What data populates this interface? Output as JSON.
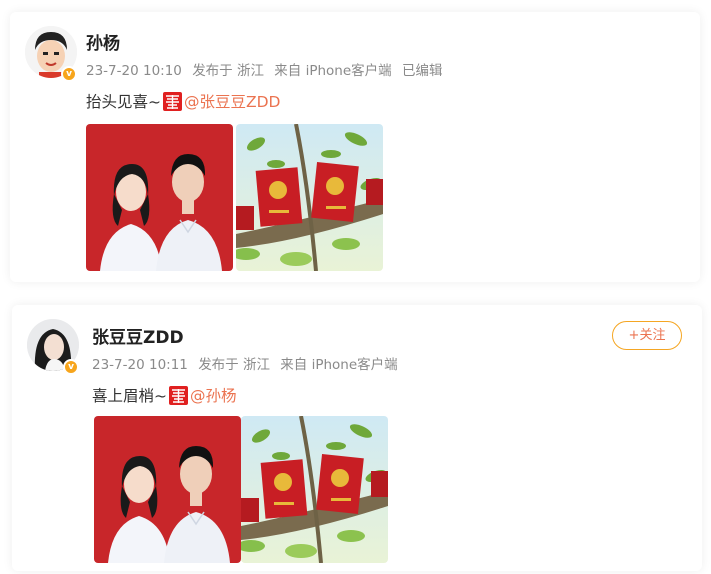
{
  "posts": [
    {
      "username": "孙杨",
      "avatar": "cartoon-avatar",
      "verified_badge": "v",
      "meta": {
        "time": "23-7-20 10:10",
        "location": "发布于 浙江",
        "source": "来自 iPhone客户端",
        "edited": "已编辑"
      },
      "text": {
        "prefix": "抬头见喜~",
        "icon": "double-happiness-icon",
        "mention": "@张豆豆ZDD"
      },
      "images": [
        "couple-portrait",
        "marriage-certificates-in-tree"
      ]
    },
    {
      "username": "张豆豆ZDD",
      "avatar": "woman-portrait-avatar",
      "verified_badge": "v",
      "follow_label": "+关注",
      "meta": {
        "time": "23-7-20 10:11",
        "location": "发布于 浙江",
        "source": "来自 iPhone客户端"
      },
      "text": {
        "prefix": "喜上眉梢~",
        "icon": "double-happiness-icon",
        "mention": "@孙杨"
      },
      "images": [
        "couple-portrait",
        "marriage-certificates-in-tree"
      ]
    }
  ],
  "colors": {
    "mention": "#eb7350",
    "badge": "#f7a51c",
    "follow_border": "#f5a623",
    "meta": "#8a8a8a"
  }
}
